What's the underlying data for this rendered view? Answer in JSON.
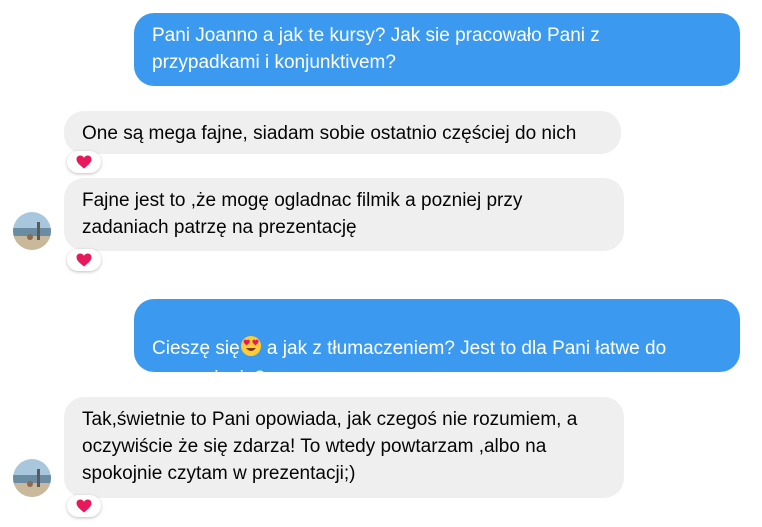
{
  "messages": [
    {
      "from": "me",
      "text": "Pani Joanno a jak te kursy? Jak sie pracowało Pani z\nprzypadkami i konjunktivem?"
    },
    {
      "from": "them",
      "text": "One są mega fajne, siadam sobie ostatnio częściej do nich",
      "reaction": "heart-icon"
    },
    {
      "from": "them",
      "text": "Fajne jest to ,że mogę ogladnac filmik a pozniej przy\nzadaniach patrzę na prezentację",
      "reaction": "heart-icon"
    },
    {
      "from": "me",
      "text_before": "Cieszę się",
      "emoji": "heart-eyes-emoji",
      "text_after": " a jak z tłumaczeniem? Jest to dla Pani łatwe do\nzrozumienia?"
    },
    {
      "from": "them",
      "text": "Tak,świetnie to Pani opowiada, jak czegoś nie rozumiem, a\noczywiście że się zdarza! To wtedy powtarzam ,albo na\nspokojnie czytam w prezentacji;)",
      "reaction": "heart-icon"
    }
  ],
  "colors": {
    "sent_bubble": "#3b9af0",
    "received_bubble": "#efefef",
    "reaction_heart": "#e8185c"
  }
}
